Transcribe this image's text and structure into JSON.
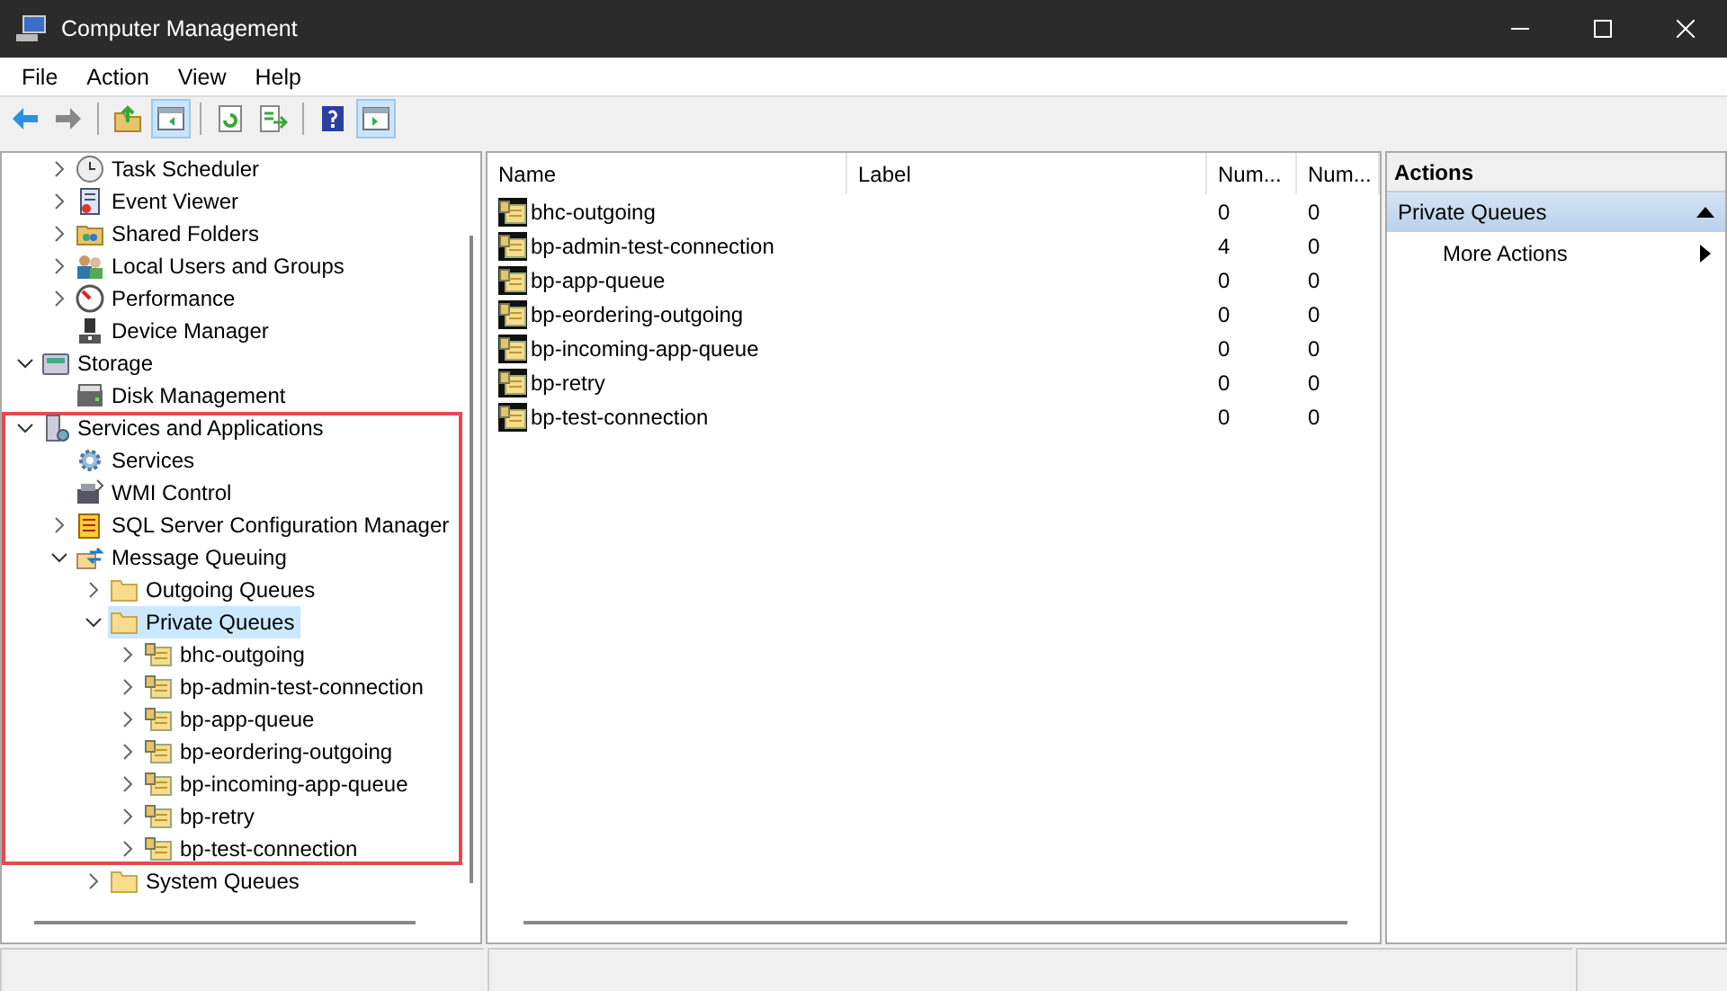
{
  "window": {
    "title": "Computer Management"
  },
  "menu": [
    "File",
    "Action",
    "View",
    "Help"
  ],
  "toolbar": [
    {
      "kind": "back",
      "pressed": false
    },
    {
      "kind": "forward",
      "pressed": false
    },
    {
      "kind": "separator"
    },
    {
      "kind": "up",
      "pressed": false
    },
    {
      "kind": "tree-pane",
      "pressed": true
    },
    {
      "kind": "separator"
    },
    {
      "kind": "refresh",
      "pressed": false
    },
    {
      "kind": "export",
      "pressed": false
    },
    {
      "kind": "separator"
    },
    {
      "kind": "help",
      "pressed": false
    },
    {
      "kind": "action-pane",
      "pressed": true
    }
  ],
  "tree": [
    {
      "children": [
        {
          "label": "Task Scheduler",
          "expanded": false,
          "selected": false,
          "highlighted": false
        },
        {
          "label": "Event Viewer",
          "expanded": false,
          "selected": false,
          "highlighted": false
        },
        {
          "label": "Shared Folders",
          "expanded": false,
          "selected": false,
          "highlighted": false
        },
        {
          "label": "Local Users and Groups",
          "expanded": false,
          "selected": false,
          "highlighted": false
        },
        {
          "label": "Performance",
          "expanded": false,
          "selected": false,
          "highlighted": false
        },
        {
          "label": "Device Manager",
          "selected": false,
          "highlighted": false
        }
      ]
    },
    {
      "label": "Storage",
      "expanded": true,
      "selected": false,
      "highlighted": false,
      "children": [
        {
          "label": "Disk Management",
          "selected": false,
          "highlighted": false
        }
      ]
    },
    {
      "label": "Services and Applications",
      "expanded": true,
      "selected": false,
      "highlighted": true,
      "children": [
        {
          "label": "Services",
          "selected": false,
          "highlighted": true
        },
        {
          "label": "WMI Control",
          "selected": false,
          "highlighted": true
        },
        {
          "label": "SQL Server Configuration Manager",
          "expanded": false,
          "selected": false,
          "highlighted": true
        },
        {
          "label": "Message Queuing",
          "expanded": true,
          "selected": false,
          "highlighted": true,
          "children": [
            {
              "label": "Outgoing Queues",
              "expanded": false,
              "selected": false,
              "highlighted": true
            },
            {
              "label": "Private Queues",
              "expanded": true,
              "selected": true,
              "highlighted": true,
              "children": [
                {
                  "label": "bhc-outgoing",
                  "expanded": false,
                  "selected": false,
                  "highlighted": true
                },
                {
                  "label": "bp-admin-test-connection",
                  "expanded": false,
                  "selected": false,
                  "highlighted": true
                },
                {
                  "label": "bp-app-queue",
                  "expanded": false,
                  "selected": false,
                  "highlighted": true
                },
                {
                  "label": "bp-eordering-outgoing",
                  "expanded": false,
                  "selected": false,
                  "highlighted": true
                },
                {
                  "label": "bp-incoming-app-queue",
                  "expanded": false,
                  "selected": false,
                  "highlighted": true
                },
                {
                  "label": "bp-retry",
                  "expanded": false,
                  "selected": false,
                  "highlighted": true
                },
                {
                  "label": "bp-test-connection",
                  "expanded": false,
                  "selected": false,
                  "highlighted": true
                }
              ]
            },
            {
              "label": "System Queues",
              "expanded": false,
              "selected": false,
              "highlighted": false
            }
          ]
        }
      ]
    }
  ],
  "list": {
    "columns": [
      "Name",
      "Label",
      "Num...",
      "Num..."
    ],
    "rows": [
      {
        "name": "bhc-outgoing",
        "num_1": "0",
        "num_2": "0"
      },
      {
        "name": "bp-admin-test-connection",
        "num_1": "4",
        "num_2": "0"
      },
      {
        "name": "bp-app-queue",
        "num_1": "0",
        "num_2": "0"
      },
      {
        "name": "bp-eordering-outgoing",
        "num_1": "0",
        "num_2": "0"
      },
      {
        "name": "bp-incoming-app-queue",
        "num_1": "0",
        "num_2": "0"
      },
      {
        "name": "bp-retry",
        "num_1": "0",
        "num_2": "0"
      },
      {
        "name": "bp-test-connection",
        "num_1": "0",
        "num_2": "0"
      }
    ]
  },
  "actions": {
    "title": "Actions",
    "section": {
      "label": "Private Queues",
      "expanded": true
    },
    "items": [
      "More Actions"
    ]
  }
}
